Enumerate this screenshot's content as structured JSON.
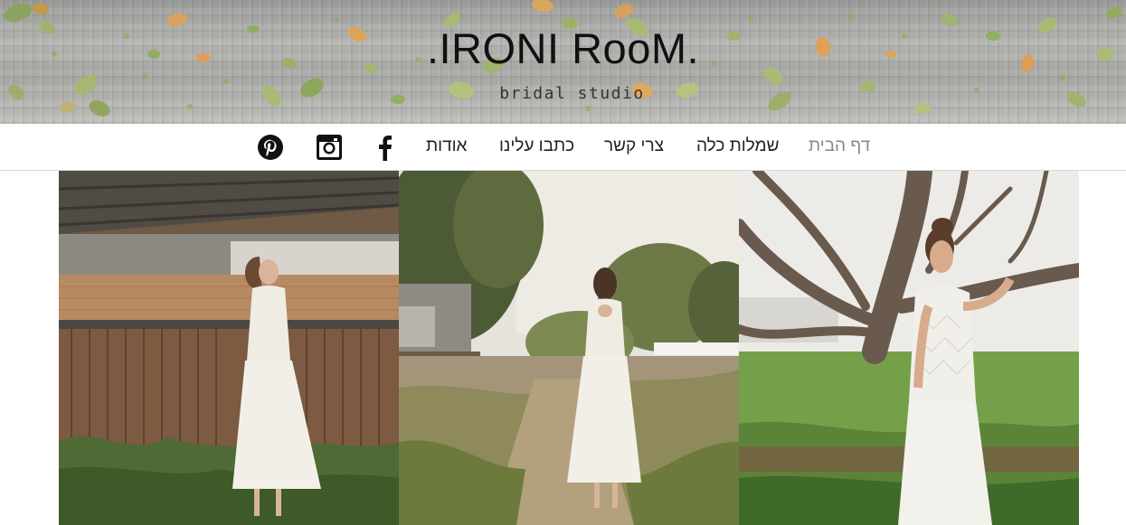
{
  "header": {
    "title": ".IRONI RooM.",
    "subtitle": "bridal studio"
  },
  "nav": {
    "items": [
      {
        "label": "דף הבית",
        "active": true
      },
      {
        "label": "שמלות כלה",
        "active": false
      },
      {
        "label": "צרי קשר",
        "active": false
      },
      {
        "label": "כתבו עלינו",
        "active": false
      },
      {
        "label": "אודות",
        "active": false
      }
    ],
    "social": [
      "facebook-icon",
      "instagram-icon",
      "pinterest-icon"
    ]
  },
  "gallery": {
    "photos": [
      "photo-bride-by-wooden-fence",
      "photo-bride-from-back-in-yard",
      "photo-bride-by-tree"
    ]
  },
  "colors": {
    "nav_active": "#888888",
    "nav_text": "#222222",
    "title": "#111111"
  }
}
